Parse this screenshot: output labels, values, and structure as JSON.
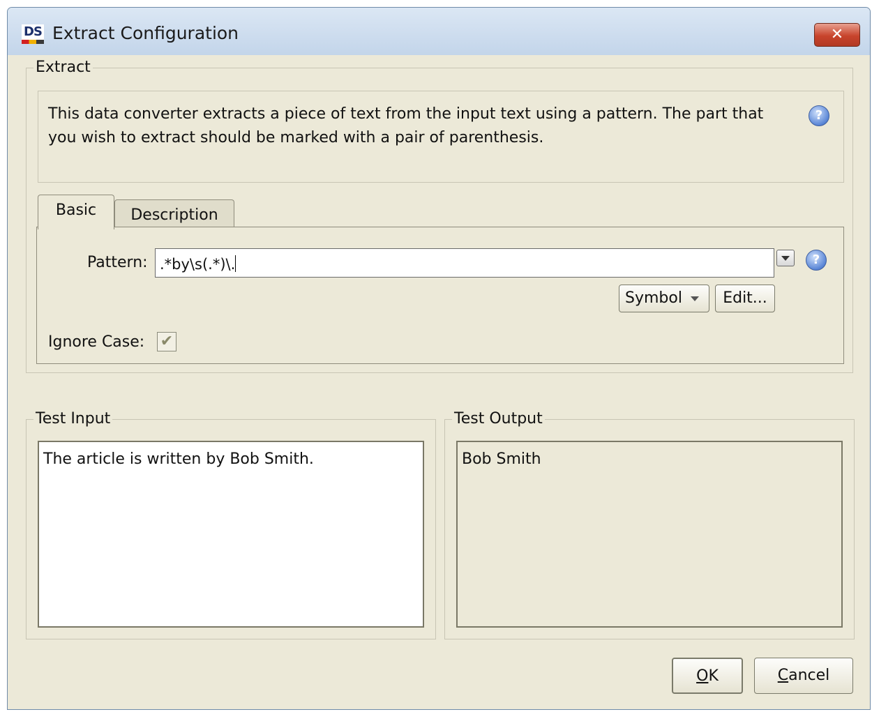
{
  "window": {
    "icon_text": "DS",
    "title": "Extract Configuration",
    "close_symbol": "✕"
  },
  "extract_group": {
    "legend": "Extract",
    "description": "This data converter extracts a piece of text from the input text using a pattern. The part that you wish to extract should be marked with a pair of parenthesis.",
    "help_symbol": "?"
  },
  "tabs": [
    {
      "label": "Basic",
      "selected": true
    },
    {
      "label": "Description",
      "selected": false
    }
  ],
  "basic": {
    "pattern_label": "Pattern:",
    "pattern_value": ".*by\\s(.*)\\.",
    "symbol_label": "Symbol",
    "edit_label": "Edit...",
    "ignore_case_label": "Ignore Case:",
    "ignore_case_checked": true,
    "check_symbol": "✔"
  },
  "test_input": {
    "legend": "Test Input",
    "value": "The article is written by Bob Smith."
  },
  "test_output": {
    "legend": "Test Output",
    "value": "Bob Smith"
  },
  "buttons": {
    "ok_mnemonic": "O",
    "ok_rest": "K",
    "cancel_mnemonic": "C",
    "cancel_rest": "ancel"
  },
  "icons": [
    "ds-app-icon",
    "close-icon",
    "help-icon",
    "chevron-down-icon",
    "checkmark-icon"
  ]
}
